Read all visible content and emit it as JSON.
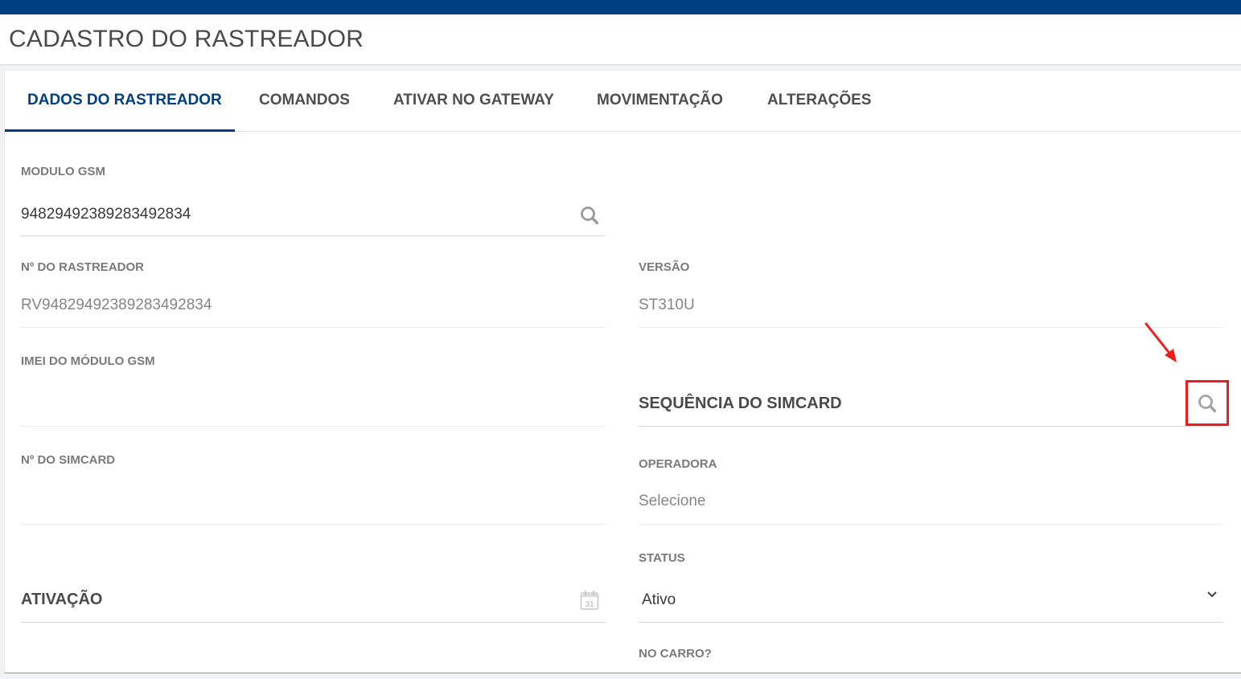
{
  "header": {
    "title": "CADASTRO DO RASTREADOR"
  },
  "tabs": [
    {
      "label": "DADOS DO RASTREADOR",
      "active": true
    },
    {
      "label": "COMANDOS",
      "active": false
    },
    {
      "label": "ATIVAR NO GATEWAY",
      "active": false
    },
    {
      "label": "MOVIMENTAÇÃO",
      "active": false
    },
    {
      "label": "ALTERAÇÕES",
      "active": false
    }
  ],
  "form": {
    "modulo_gsm": {
      "label": "MODULO GSM",
      "value": "94829492389283492834",
      "icon": "search-icon"
    },
    "numero_rastreador": {
      "label": "Nº DO RASTREADOR",
      "value": "RV94829492389283492834"
    },
    "versao": {
      "label": "VERSÃO",
      "value": "ST310U"
    },
    "imei_modulo_gsm": {
      "label": "IMEI DO MÓDULO GSM",
      "value": ""
    },
    "sequencia_simcard": {
      "label": "SEQUÊNCIA DO SIMCARD",
      "icon": "search-icon",
      "highlighted": true
    },
    "numero_simcard": {
      "label": "Nº DO SIMCARD",
      "value": ""
    },
    "operadora": {
      "label": "OPERADORA",
      "placeholder": "Selecione"
    },
    "ativacao": {
      "label": "ATIVAÇÃO",
      "icon": "calendar-icon",
      "calendar_day": "31"
    },
    "status": {
      "label": "STATUS",
      "value": "Ativo",
      "icon": "chevron-down-icon"
    },
    "no_carro": {
      "label": "NO CARRO?"
    }
  },
  "colors": {
    "brand": "#003f82",
    "annotation": "#ee1c1c"
  }
}
